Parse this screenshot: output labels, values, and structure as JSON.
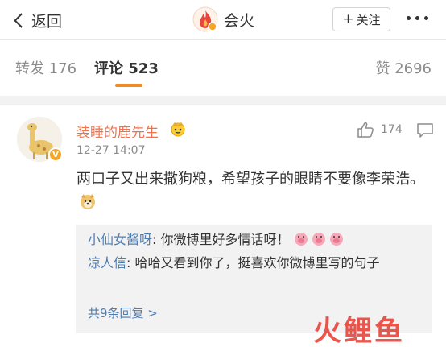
{
  "nav": {
    "back_label": "返回",
    "title": "会火",
    "follow_label": "关注"
  },
  "tabs": {
    "repost": "转发 176",
    "comment": "评论 523",
    "like": "赞 2696"
  },
  "comment": {
    "username": "装睡的鹿先生",
    "time": "12-27 14:07",
    "likes": "174",
    "text": "两口子又出来撒狗粮，希望孩子的眼睛不要像李荣浩。",
    "badge": "V"
  },
  "replies": [
    {
      "user": "小仙女酱呀",
      "text": ": 你微博里好多情话呀！"
    },
    {
      "user": "凉人信",
      "text": ": 哈哈又看到你了，挺喜欢你微博里写的句子"
    }
  ],
  "more_replies": "共9条回复 >",
  "watermark": [
    "火",
    "鲤",
    "鱼"
  ],
  "colors": {
    "accent": "#f08a24",
    "username": "#eb7350",
    "link": "#507daf",
    "watermark": "#e8453c"
  }
}
